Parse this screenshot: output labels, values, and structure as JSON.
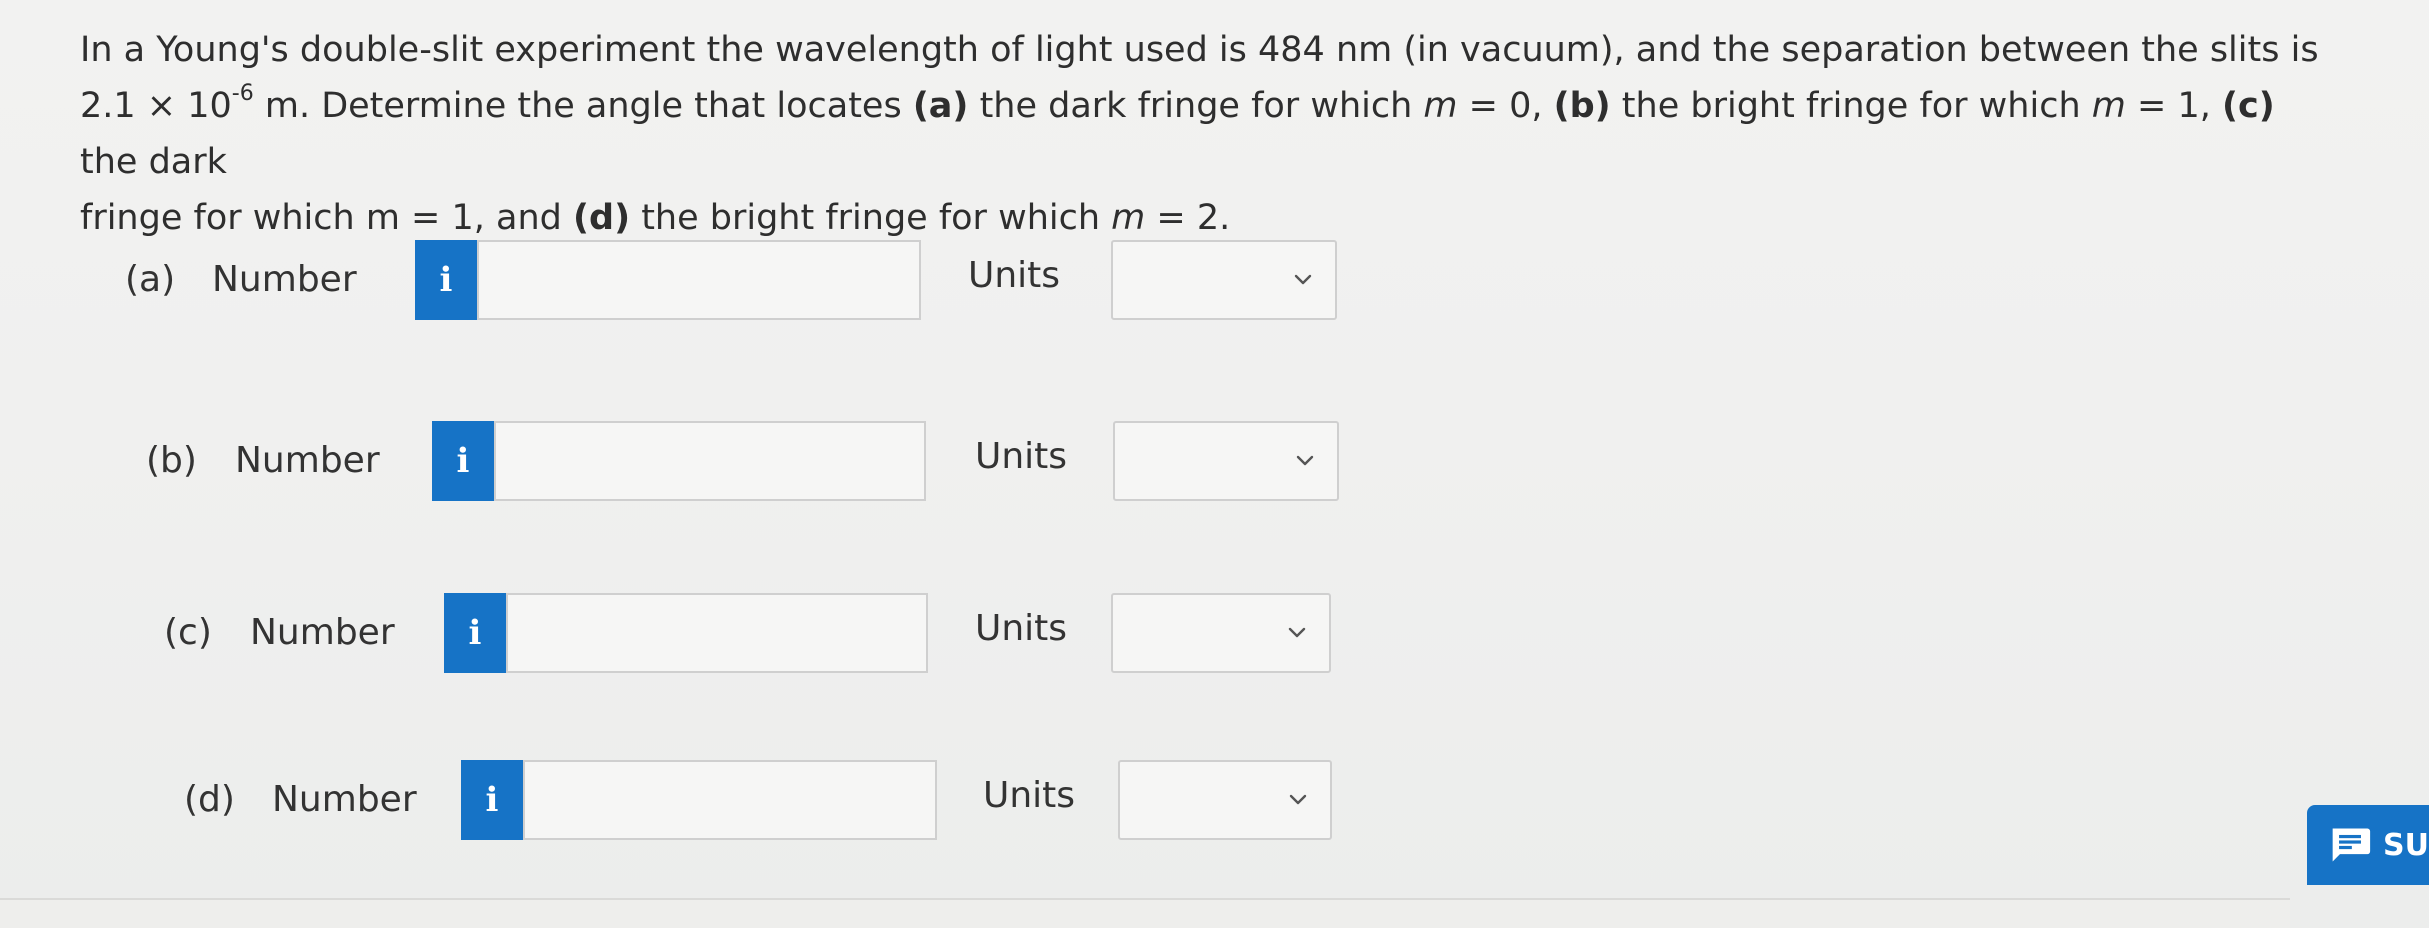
{
  "question": {
    "line1_pre": "In a Young's double-slit experiment the wavelength of light used is 484 nm (in vacuum), and the separation between the slits is",
    "line2_mantissa": "2.1 × 10",
    "line2_exponent": "-6",
    "line2_rest_a": " m. Determine the angle that locates ",
    "a_tag": "(a)",
    "a_text": " the dark fringe for which ",
    "m_var": "m",
    "eq0": " = 0, ",
    "b_tag": "(b)",
    "b_text": " the bright fringe for which ",
    "eq1": " = 1, ",
    "c_tag": "(c)",
    "c_text": " the dark",
    "line3_a": "fringe for which ",
    "line3_eq1": "m = 1",
    "line3_and": ", and ",
    "d_tag": "(d)",
    "d_text": " the bright fringe for which ",
    "eq2": " = 2."
  },
  "parts": [
    {
      "tag": "(a)",
      "number_label": "Number",
      "info_glyph": "i",
      "number_value": "",
      "units_label": "Units",
      "units_value": ""
    },
    {
      "tag": "(b)",
      "number_label": "Number",
      "info_glyph": "i",
      "number_value": "",
      "units_label": "Units",
      "units_value": ""
    },
    {
      "tag": "(c)",
      "number_label": "Number",
      "info_glyph": "i",
      "number_value": "",
      "units_label": "Units",
      "units_value": ""
    },
    {
      "tag": "(d)",
      "number_label": "Number",
      "info_glyph": "i",
      "number_value": "",
      "units_label": "Units",
      "units_value": ""
    }
  ],
  "submit_tab": {
    "label": "SU",
    "icon": "chat-bubble-icon"
  },
  "colors": {
    "accent": "#1673c6",
    "background": "#f0f0ef",
    "text": "#2e2e2e"
  }
}
